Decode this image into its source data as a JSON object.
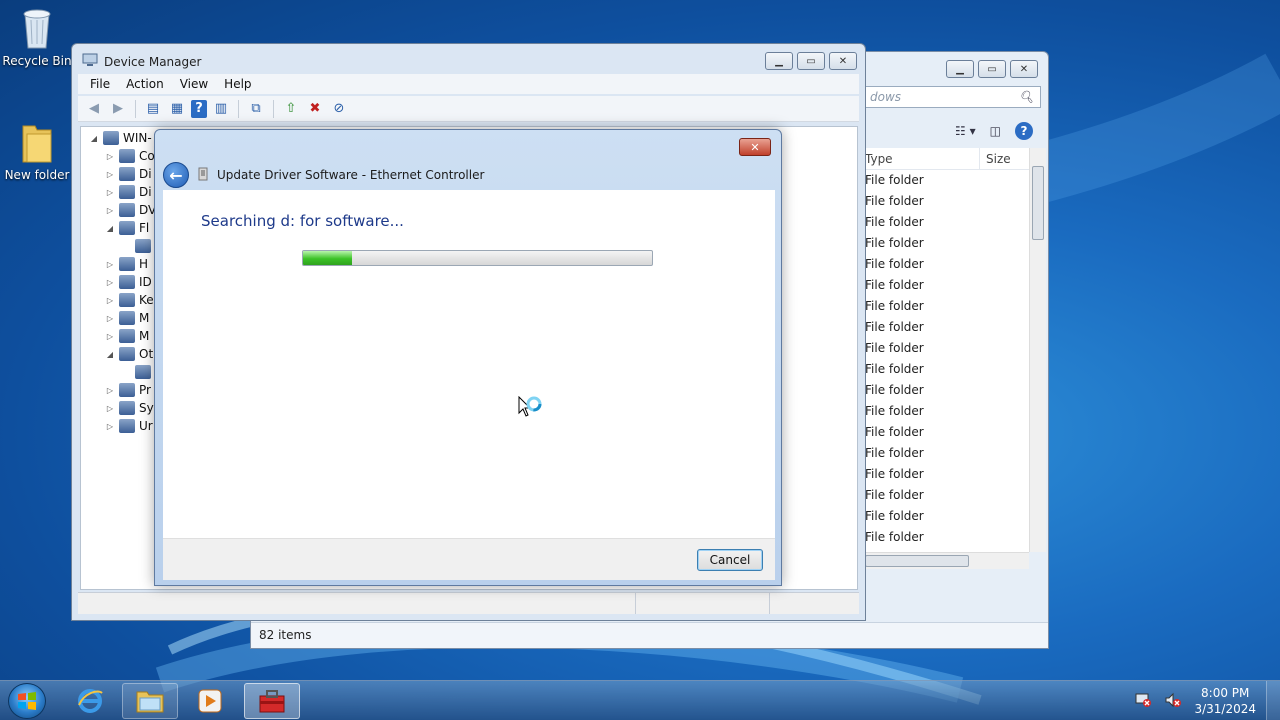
{
  "desktop": {
    "icons": [
      {
        "label": "Recycle Bin",
        "icon": "recycle-bin-icon"
      },
      {
        "label": "New folder",
        "icon": "folder-icon"
      }
    ]
  },
  "explorer": {
    "search_placeholder": "dows",
    "columns": {
      "type": "Type",
      "size": "Size"
    },
    "rows": [
      "File folder",
      "File folder",
      "File folder",
      "File folder",
      "File folder",
      "File folder",
      "File folder",
      "File folder",
      "File folder",
      "File folder",
      "File folder",
      "File folder",
      "File folder",
      "File folder",
      "File folder",
      "File folder",
      "File folder",
      "File folder"
    ],
    "status": "82 items"
  },
  "device_manager": {
    "title": "Device Manager",
    "menu": [
      "File",
      "Action",
      "View",
      "Help"
    ],
    "tree": [
      {
        "label": "WIN-",
        "arrow": "◢",
        "indent": 0
      },
      {
        "label": "Co",
        "arrow": "▷",
        "indent": 1
      },
      {
        "label": "Di",
        "arrow": "▷",
        "indent": 1
      },
      {
        "label": "Di",
        "arrow": "▷",
        "indent": 1
      },
      {
        "label": "DV",
        "arrow": "▷",
        "indent": 1
      },
      {
        "label": "Fl",
        "arrow": "◢",
        "indent": 1
      },
      {
        "label": "",
        "arrow": "",
        "indent": 2
      },
      {
        "label": "H",
        "arrow": "▷",
        "indent": 1
      },
      {
        "label": "ID",
        "arrow": "▷",
        "indent": 1
      },
      {
        "label": "Ke",
        "arrow": "▷",
        "indent": 1
      },
      {
        "label": "M",
        "arrow": "▷",
        "indent": 1
      },
      {
        "label": "M",
        "arrow": "▷",
        "indent": 1
      },
      {
        "label": "Ot",
        "arrow": "◢",
        "indent": 1
      },
      {
        "label": "",
        "arrow": "",
        "indent": 2
      },
      {
        "label": "Pr",
        "arrow": "▷",
        "indent": 1
      },
      {
        "label": "Sy",
        "arrow": "▷",
        "indent": 1
      },
      {
        "label": "Ur",
        "arrow": "▷",
        "indent": 1
      }
    ]
  },
  "wizard": {
    "title": "Update Driver Software - Ethernet Controller",
    "heading": "Searching d: for software...",
    "progress": 0.14,
    "cancel_label": "Cancel"
  },
  "taskbar": {
    "apps": [
      {
        "name": "internet-explorer",
        "icon": "ie-icon"
      },
      {
        "name": "windows-explorer",
        "icon": "folder-icon"
      },
      {
        "name": "media-player",
        "icon": "media-player-icon"
      },
      {
        "name": "device-manager",
        "icon": "toolbox-icon"
      }
    ],
    "time": "8:00 PM",
    "date": "3/31/2024"
  }
}
